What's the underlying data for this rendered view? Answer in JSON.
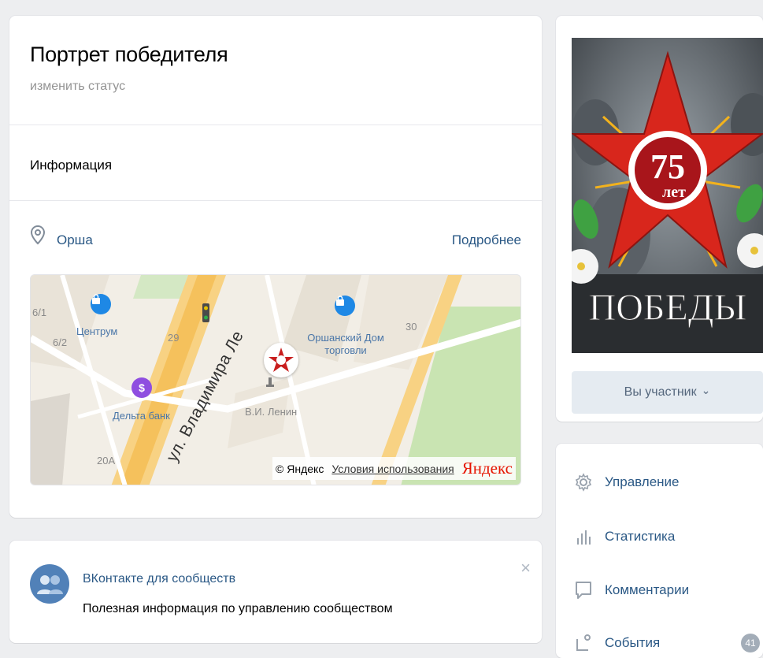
{
  "header": {
    "title": "Портрет победителя",
    "status_link": "изменить статус"
  },
  "info": {
    "label": "Информация"
  },
  "address": {
    "city": "Орша",
    "more_link": "Подробнее"
  },
  "map": {
    "labels": {
      "tsentrum": "Центрум",
      "orshansky": "Оршанский Дом торговли",
      "delta": "Дельта банк",
      "lenin": "В.И. Ленин",
      "street": "ул. Владимира Ле",
      "num_61": "6/1",
      "num_62": "6/2",
      "num_29": "29",
      "num_30": "30",
      "num_20a": "20А"
    },
    "attribution": "© Яндекс",
    "terms": "Условия использования",
    "brand": "Яндекс"
  },
  "promo": {
    "title": "ВКонтакте для сообществ",
    "text": "Полезная информация по управлению сообществом",
    "close": "×"
  },
  "cover": {
    "number": "75",
    "years": "лет",
    "word": "ПОБЕДЫ"
  },
  "membership": {
    "button_label": "Вы участник",
    "chevron": "⌄"
  },
  "menu": {
    "items": [
      {
        "label": "Управление",
        "icon": "gear-icon"
      },
      {
        "label": "Статистика",
        "icon": "stats-icon"
      },
      {
        "label": "Комментарии",
        "icon": "comment-icon"
      },
      {
        "label": "События",
        "icon": "events-icon",
        "badge": "41"
      }
    ]
  },
  "colors": {
    "link": "#2a5885",
    "accent": "#5181b8",
    "background": "#edeef0",
    "button_bg": "#e5ebf1"
  }
}
